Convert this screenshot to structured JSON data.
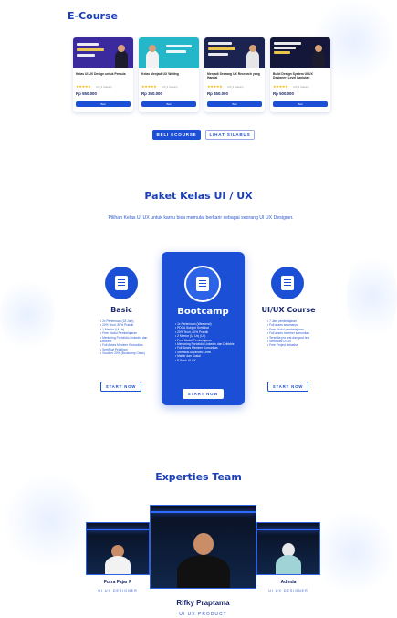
{
  "ecourse": {
    "title": "E-Course",
    "cards": [
      {
        "thumb_text": "Kelas UI UX Design untuk Pemula",
        "title": "Kelas UI UX Design untuk Pemula",
        "stars": "★★★★★",
        "reviews": "4.8 (1 Ulasan)",
        "price": "Rp 550.000",
        "buy": "Beli",
        "color": "#3a2a9e"
      },
      {
        "thumb_text": "Kelas Menjadi UX Writing",
        "title": "Kelas Menjadi UX Writing",
        "stars": "★★★★★",
        "reviews": "4.8 (1 Ulasan)",
        "price": "Rp 350.000",
        "buy": "Beli",
        "color": "#23b7c9"
      },
      {
        "thumb_text": "Menjadi Seorang UX Research yang Handal",
        "title": "Menjadi Seorang UX Research yang Handal",
        "stars": "★★★★★",
        "reviews": "4.8 (1 Ulasan)",
        "price": "Rp 450.000",
        "buy": "Beli",
        "color": "#1b2450"
      },
      {
        "thumb_text": "Build Design System UI UX Designer: Level Lanjutan",
        "title": "Build Design System UI UX Designer: Level Lanjutan",
        "stars": "★★★★★",
        "reviews": "4.8 (1 Ulasan)",
        "price": "Rp 500.000",
        "buy": "Beli",
        "color": "#15173a"
      }
    ],
    "buy_button": "BELI ECOURSE",
    "syllabus_button": "LIHAT SILABUS"
  },
  "packages": {
    "title": "Paket Kelas UI / UX",
    "subtitle": "Pilihan Kelas UI UX untuk kamu bisa memulai berkarir sebagai seorang UI UX Designer.",
    "basic": {
      "name": "Basic",
      "features": [
        "2x Pertemuan (18 Jam)",
        "20% Teori, 80% Praktik",
        "1 Mentor (Ui Ux)",
        "Free Modul Pembelajaran",
        "Mentoring Portofolio LinkedIn dan Dribbble",
        "Full Akses Member Komunitas",
        "Sertifikat Pelatihan",
        "Voucher 20% (Bootcamp Class)"
      ],
      "button": "START NOW"
    },
    "bootcamp": {
      "name": "Bootcamp",
      "features": [
        "1x Pertemuan (Weekend)",
        "PDCA Subject Sertifikat",
        "20% Teori, 80% Praktik",
        "2 Mentor (Ui Ux) (Ux)",
        "Free Modul Pembelajaran",
        "Mentoring Portofolio LinkedIn dan Dribbble",
        "Full Akses Member Komunitas",
        "Sertifikat Advanced Level",
        "Mabar dan Sosial",
        "E-Book UI UX"
      ],
      "button": "START NOW"
    },
    "uiux": {
      "name": "UI/UX Course",
      "features": [
        "7 Jam pembelajaran",
        "Full akses selamanya",
        "Free Modul pembelajaran",
        "Full akses member komunitas",
        "Tersedia pre test dan post test",
        "Sertifikasi UI UX",
        "Free Project Ilmiasha"
      ],
      "button": "START NOW"
    }
  },
  "experts": {
    "title": "Experties Team",
    "people": [
      {
        "name": "Futra Fajar F",
        "role": "UI UX DESIGNER"
      },
      {
        "name": "Rifky Praptama",
        "role": "UI UX PRODUCT"
      },
      {
        "name": "Adinda",
        "role": "UI UX DESIGNER"
      }
    ]
  },
  "colors": {
    "accent": "#1a4fd6",
    "heading": "#1a3fb8"
  }
}
